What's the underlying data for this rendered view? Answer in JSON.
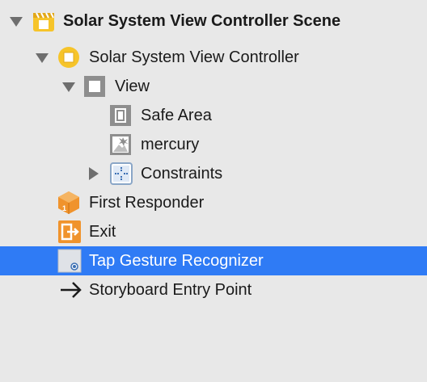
{
  "outline": {
    "rows": [
      {
        "label": "Solar System View Controller Scene",
        "icon": "scene-icon"
      },
      {
        "label": "Solar System View Controller",
        "icon": "view-controller-icon"
      },
      {
        "label": "View",
        "icon": "view-icon"
      },
      {
        "label": "Safe Area",
        "icon": "safe-area-icon"
      },
      {
        "label": "mercury",
        "icon": "image-view-icon"
      },
      {
        "label": "Constraints",
        "icon": "constraints-icon"
      },
      {
        "label": "First Responder",
        "icon": "first-responder-icon"
      },
      {
        "label": "Exit",
        "icon": "exit-icon"
      },
      {
        "label": "Tap Gesture Recognizer",
        "icon": "tap-gesture-icon"
      },
      {
        "label": "Storyboard Entry Point",
        "icon": "entry-point-arrow-icon"
      }
    ],
    "selected_row": "Tap Gesture Recognizer",
    "colors": {
      "selection": "#2f7bf5",
      "accent_yellow": "#f6c42a",
      "accent_orange": "#f0932c"
    }
  }
}
